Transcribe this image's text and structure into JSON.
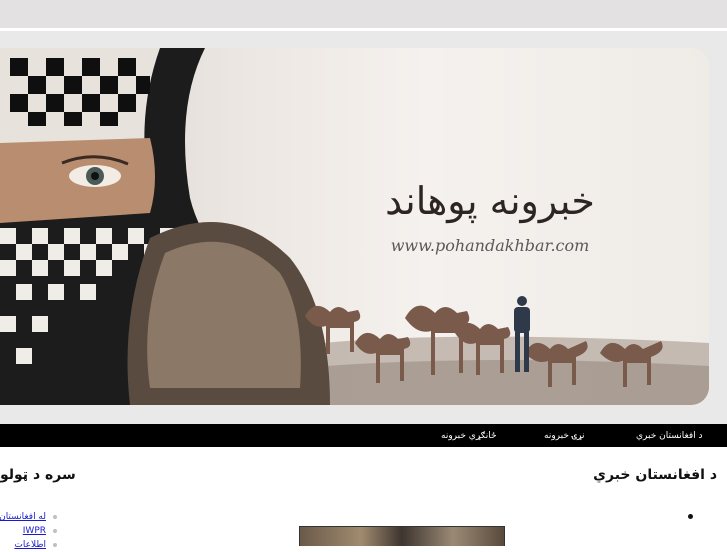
{
  "banner": {
    "title": "خبرونه پوهاند",
    "url": "www.pohandakhbar.com"
  },
  "nav": {
    "items": [
      {
        "label": "د افغانستان خبري"
      },
      {
        "label": "نړۍ خبرونه"
      },
      {
        "label": "ځانګړي خبرونه"
      }
    ]
  },
  "content": {
    "main_heading": "د افغانستان خبري",
    "side_heading": "سره د ټولو",
    "links": [
      {
        "label": "له افغانستان"
      },
      {
        "label": "IWPR"
      },
      {
        "label": "اطلاعات"
      }
    ]
  },
  "colors": {
    "navbar": "#000000",
    "top_strip": "#e3e1e2",
    "link": "#1a1acc"
  }
}
